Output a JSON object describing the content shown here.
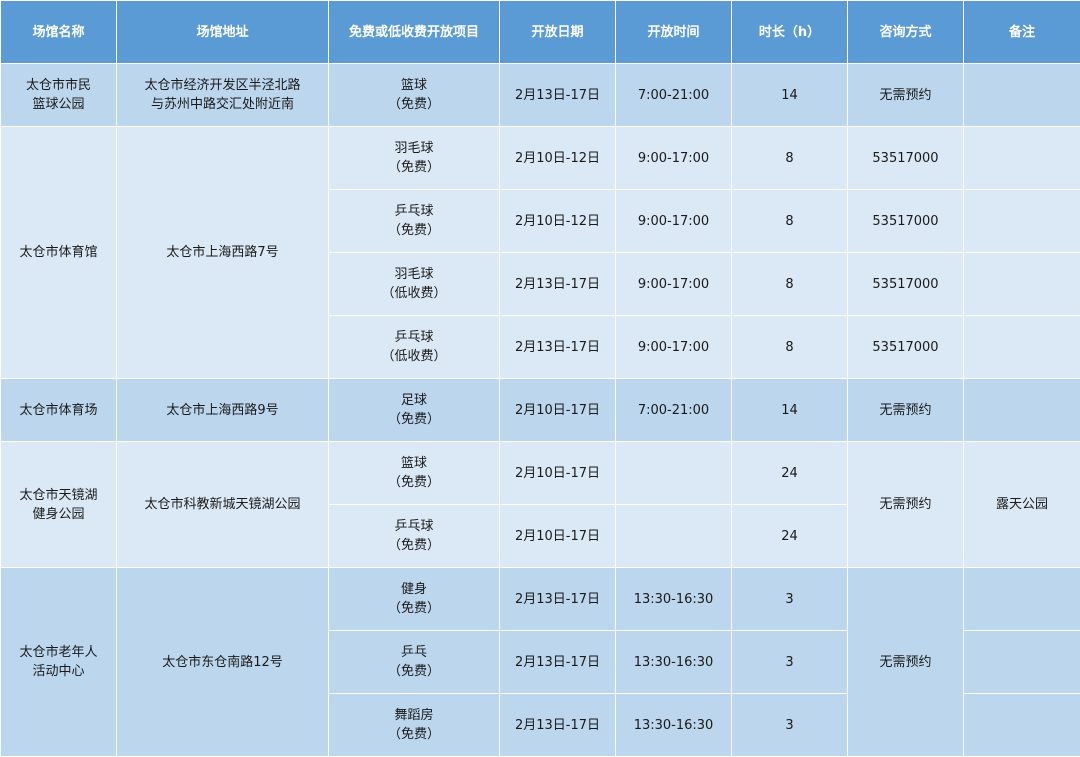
{
  "table": {
    "headers": [
      "场馆名称",
      "场馆地址",
      "免费或低收费开放项目",
      "开放日期",
      "开放时间",
      "时长（h）",
      "咨询方式",
      "备注"
    ],
    "rows": [
      {
        "venue": "太仓市市民\n篮球公园",
        "address": "太仓市经济开发区半泾北路\n与苏州中路交汇处附近南",
        "consult": "无需预约",
        "note": "",
        "items": [
          {
            "project": "篮球\n（免费）",
            "date": "2月13日-17日",
            "time": "7:00-21:00",
            "hours": "14"
          }
        ]
      },
      {
        "venue": "太仓市体育馆",
        "address": "太仓市上海西路7号",
        "items": [
          {
            "project": "羽毛球\n（免费）",
            "date": "2月10日-12日",
            "time": "9:00-17:00",
            "hours": "8",
            "consult": "53517000",
            "note": ""
          },
          {
            "project": "乒乓球\n（免费）",
            "date": "2月10日-12日",
            "time": "9:00-17:00",
            "hours": "8",
            "consult": "53517000",
            "note": ""
          },
          {
            "project": "羽毛球\n（低收费）",
            "date": "2月13日-17日",
            "time": "9:00-17:00",
            "hours": "8",
            "consult": "53517000",
            "note": ""
          },
          {
            "project": "乒乓球\n（低收费）",
            "date": "2月13日-17日",
            "time": "9:00-17:00",
            "hours": "8",
            "consult": "53517000",
            "note": ""
          }
        ]
      },
      {
        "venue": "太仓市体育场",
        "address": "太仓市上海西路9号",
        "consult": "无需预约",
        "note": "",
        "items": [
          {
            "project": "足球\n（免费）",
            "date": "2月10日-17日",
            "time": "7:00-21:00",
            "hours": "14"
          }
        ]
      },
      {
        "venue": "太仓市天镜湖\n健身公园",
        "address": "太仓市科教新城天镜湖公园",
        "consult": "无需预约",
        "note": "露天公园",
        "items": [
          {
            "project": "篮球\n（免费）",
            "date": "2月10日-17日",
            "time": "",
            "hours": "24"
          },
          {
            "project": "乒乓球\n（免费）",
            "date": "2月10日-17日",
            "time": "",
            "hours": "24"
          }
        ]
      },
      {
        "venue": "太仓市老年人\n活动中心",
        "address": "太仓市东仓南路12号",
        "consult": "无需预约",
        "items": [
          {
            "project": "健身\n（免费）",
            "date": "2月13日-17日",
            "time": "13:30-16:30",
            "hours": "3",
            "note": ""
          },
          {
            "project": "乒乓\n（免费）",
            "date": "2月13日-17日",
            "time": "13:30-16:30",
            "hours": "3",
            "note": ""
          },
          {
            "project": "舞蹈房\n（免费）",
            "date": "2月13日-17日",
            "time": "13:30-16:30",
            "hours": "3",
            "note": ""
          }
        ]
      }
    ]
  }
}
